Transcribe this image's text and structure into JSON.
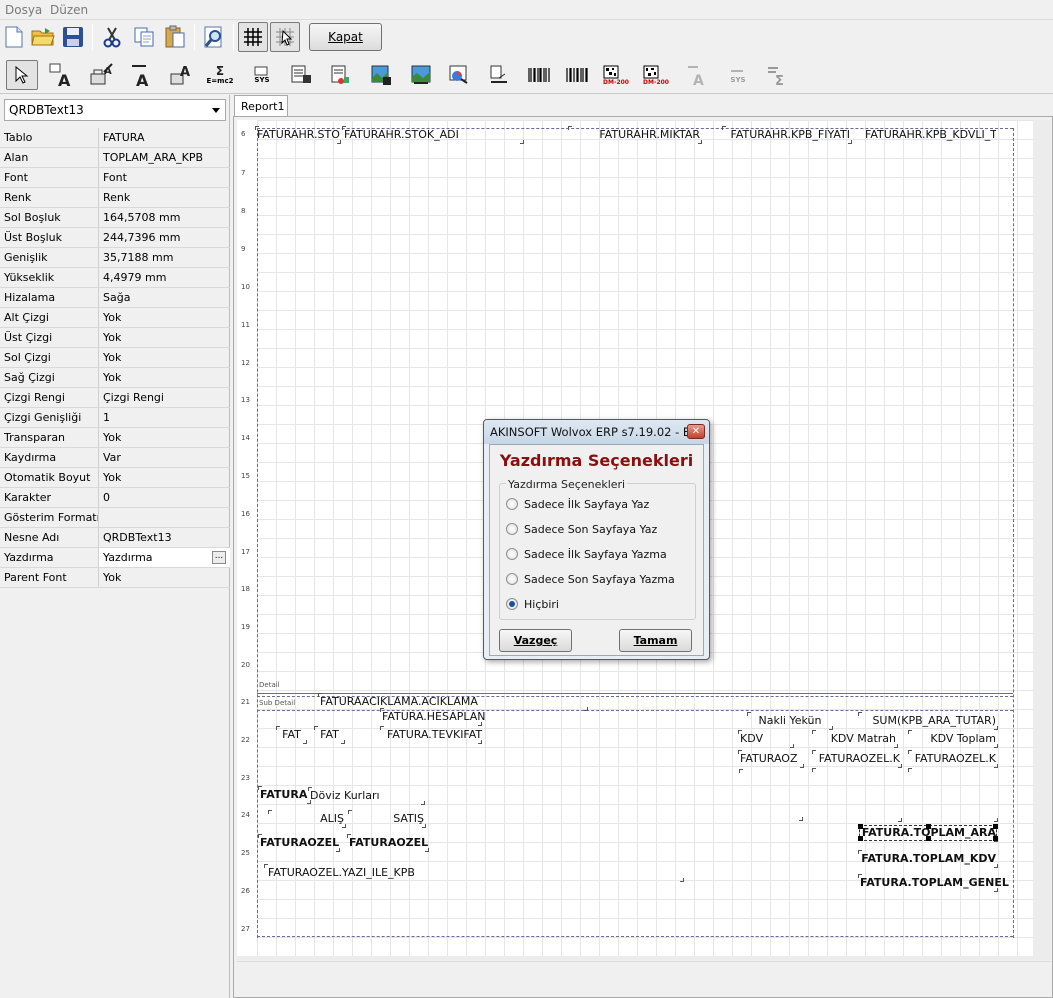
{
  "menu": [
    "Dosya",
    "Düzen"
  ],
  "toolbar": {
    "close_label": "Kapat"
  },
  "toolbar2_icons": [
    "select-pointer",
    "text-label",
    "data-field",
    "expression",
    "system-data",
    "memo",
    "rich-text",
    "image",
    "db-image",
    "chart",
    "shape",
    "barcode",
    "barcode-2",
    "datamatrix",
    "datamatrix-2",
    "disabled-text",
    "disabled-sys",
    "sigma"
  ],
  "sys_label": "SYS",
  "expr_label": "E=mc2",
  "dm_label": "DM-200",
  "combo_value": "QRDBText13",
  "properties": [
    {
      "name": "Tablo",
      "value": "FATURA"
    },
    {
      "name": "Alan",
      "value": "TOPLAM_ARA_KPB"
    },
    {
      "name": "Font",
      "value": "Font"
    },
    {
      "name": "Renk",
      "value": "Renk"
    },
    {
      "name": "Sol Boşluk",
      "value": "164,5708 mm"
    },
    {
      "name": "Üst Boşluk",
      "value": "244,7396 mm"
    },
    {
      "name": "Genişlik",
      "value": "35,7188 mm"
    },
    {
      "name": "Yükseklik",
      "value": "4,4979 mm"
    },
    {
      "name": "Hizalama",
      "value": "Sağa"
    },
    {
      "name": "Alt Çizgi",
      "value": "Yok"
    },
    {
      "name": "Üst Çizgi",
      "value": "Yok"
    },
    {
      "name": "Sol Çizgi",
      "value": "Yok"
    },
    {
      "name": "Sağ Çizgi",
      "value": "Yok"
    },
    {
      "name": "Çizgi Rengi",
      "value": "Çizgi Rengi"
    },
    {
      "name": "Çizgi Genişliği",
      "value": "1"
    },
    {
      "name": "Transparan",
      "value": "Yok"
    },
    {
      "name": "Kaydırma",
      "value": "Var"
    },
    {
      "name": "Otomatik Boyut",
      "value": "Yok"
    },
    {
      "name": "Karakter",
      "value": "0"
    },
    {
      "name": "Gösterim Formatı",
      "value": ""
    },
    {
      "name": "Nesne Adı",
      "value": "QRDBText13"
    },
    {
      "name": "Yazdırma",
      "value": "Yazdırma"
    },
    {
      "name": "Parent Font",
      "value": "Yok"
    }
  ],
  "report_tab": "Report1",
  "ruler": [
    "6",
    "7",
    "8",
    "9",
    "10",
    "11",
    "12",
    "13",
    "14",
    "15",
    "16",
    "17",
    "18",
    "19",
    "20",
    "21",
    "22",
    "23",
    "24",
    "25",
    "26",
    "27"
  ],
  "bands": {
    "detail": "Detail",
    "sub_detail": "Sub Detail"
  },
  "fields": {
    "sto": "FATURAHR.STO",
    "stok_adi": "FATURAHR.STOK_ADI",
    "miktar": "FATURAHR.MIKTAR",
    "fiyat": "FATURAHR.KPB_FIYATI",
    "kdvli": "FATURAHR.KPB_KDVLI_T",
    "aciklama": "FATURAACIKLAMA.ACIKLAMA",
    "hesaplan": "FATURA.HESAPLAN",
    "fat1": "FAT",
    "fat2": "FAT",
    "tevkifat": "FATURA.TEVKIFAT",
    "nakli": "Nakli Yekün",
    "sum": "SUM(KPB_ARA_TUTAR)",
    "kdv": "KDV",
    "kdv_matrah": "KDV Matrah",
    "kdv_toplam": "KDV Toplam",
    "faturaoz": "FATURAOZ",
    "faturaozel_k1": "FATURAOZEL.K",
    "faturaozel_k2": "FATURAOZEL.K",
    "fatura_b": "FATURA",
    "doviz": "Döviz Kurları",
    "alis": "ALIŞ",
    "satis": "SATIŞ",
    "faturaozel1": "FATURAOZEL",
    "faturaozel2": "FATURAOZEL",
    "yazi_ile": "FATURAOZEL.YAZI_ILE_KPB",
    "toplam_ara": "FATURA.TOPLAM_ARA",
    "toplam_kdv": "FATURA.TOPLAM_KDV",
    "toplam_genel": "FATURA.TOPLAM_GENEL"
  },
  "dialog": {
    "title": "AKINSOFT Wolvox ERP s7.19.02 - E...",
    "heading": "Yazdırma Seçenekleri",
    "group_caption": "Yazdırma Seçenekleri",
    "options": [
      {
        "label": "Sadece İlk Sayfaya Yaz",
        "checked": false
      },
      {
        "label": "Sadece Son Sayfaya Yaz",
        "checked": false
      },
      {
        "label": "Sadece İlk Sayfaya Yazma",
        "checked": false
      },
      {
        "label": "Sadece Son Sayfaya Yazma",
        "checked": false
      },
      {
        "label": "Hiçbiri",
        "checked": true
      }
    ],
    "cancel_label": "Vazgeç",
    "ok_label": "Tamam"
  },
  "colors": {
    "dialog_heading": "#8b0f0f",
    "radio_dot": "#1c4f9c",
    "close_button": "#c4412c"
  }
}
